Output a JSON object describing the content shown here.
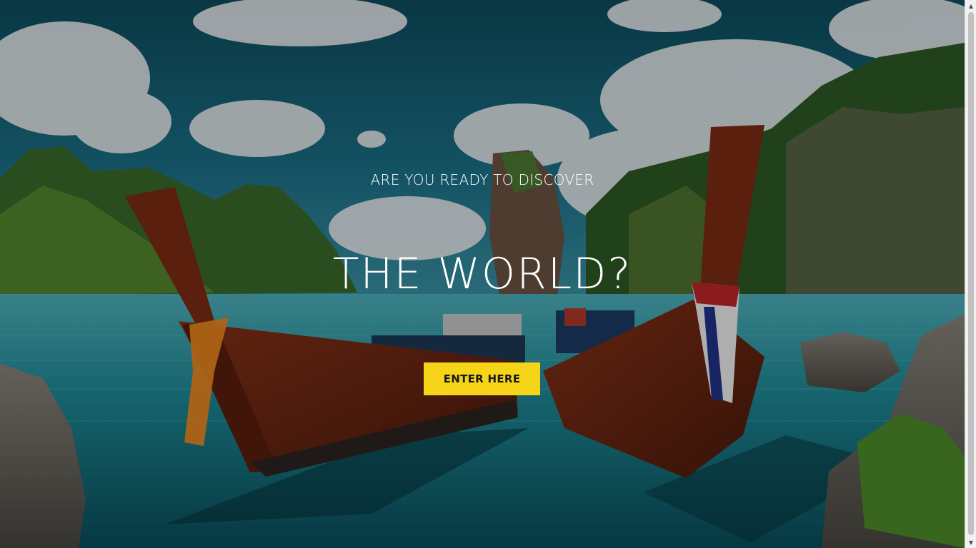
{
  "hero": {
    "eyebrow": "ARE YOU READY TO DISCOVER",
    "headline": "THE WORLD?",
    "cta_label": "ENTER HERE",
    "background_scene": "tropical-bay-longtail-boats-photo"
  },
  "colors": {
    "cta_background": "#f6d417",
    "cta_text": "#1a1a1a",
    "hero_text": "#ffffff",
    "overlay": "rgba(0,0,0,0.28)"
  },
  "scrollbar": {
    "up_icon": "chevron-up-icon",
    "down_icon": "chevron-down-icon"
  }
}
